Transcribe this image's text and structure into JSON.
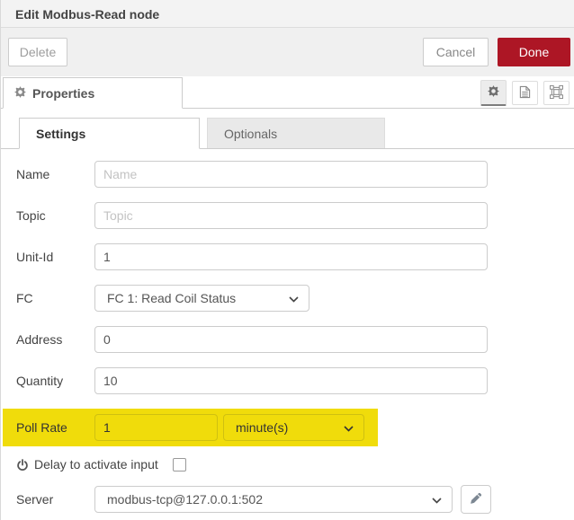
{
  "header": {
    "title": "Edit Modbus-Read node"
  },
  "buttons": {
    "delete": "Delete",
    "cancel": "Cancel",
    "done": "Done"
  },
  "properties_tab": {
    "label": "Properties"
  },
  "editor_tabs": [
    {
      "label": "Settings",
      "active": true
    },
    {
      "label": "Optionals",
      "active": false
    }
  ],
  "form": {
    "name": {
      "label": "Name",
      "placeholder": "Name",
      "value": ""
    },
    "topic": {
      "label": "Topic",
      "placeholder": "Topic",
      "value": ""
    },
    "unit_id": {
      "label": "Unit-Id",
      "value": "1"
    },
    "fc": {
      "label": "FC",
      "value": "FC 1: Read Coil Status"
    },
    "address": {
      "label": "Address",
      "value": "0"
    },
    "quantity": {
      "label": "Quantity",
      "value": "10"
    },
    "poll_rate": {
      "label": "Poll Rate",
      "value": "1",
      "unit": "minute(s)"
    },
    "delay": {
      "label": "Delay to activate input",
      "checked": false
    },
    "server": {
      "label": "Server",
      "value": "modbus-tcp@127.0.0.1:502"
    }
  },
  "colors": {
    "done_button": "#ad1625",
    "highlight": "#f0dc0b",
    "header_bg": "#f3f3f3"
  },
  "icons": {
    "properties_tab": "gear-icon",
    "toolbar": [
      "gear-icon",
      "document-icon",
      "appearance-frame-icon"
    ],
    "delay_row": "power-icon",
    "server_edit": "pencil-icon",
    "dropdowns": "chevron-down-icon"
  }
}
